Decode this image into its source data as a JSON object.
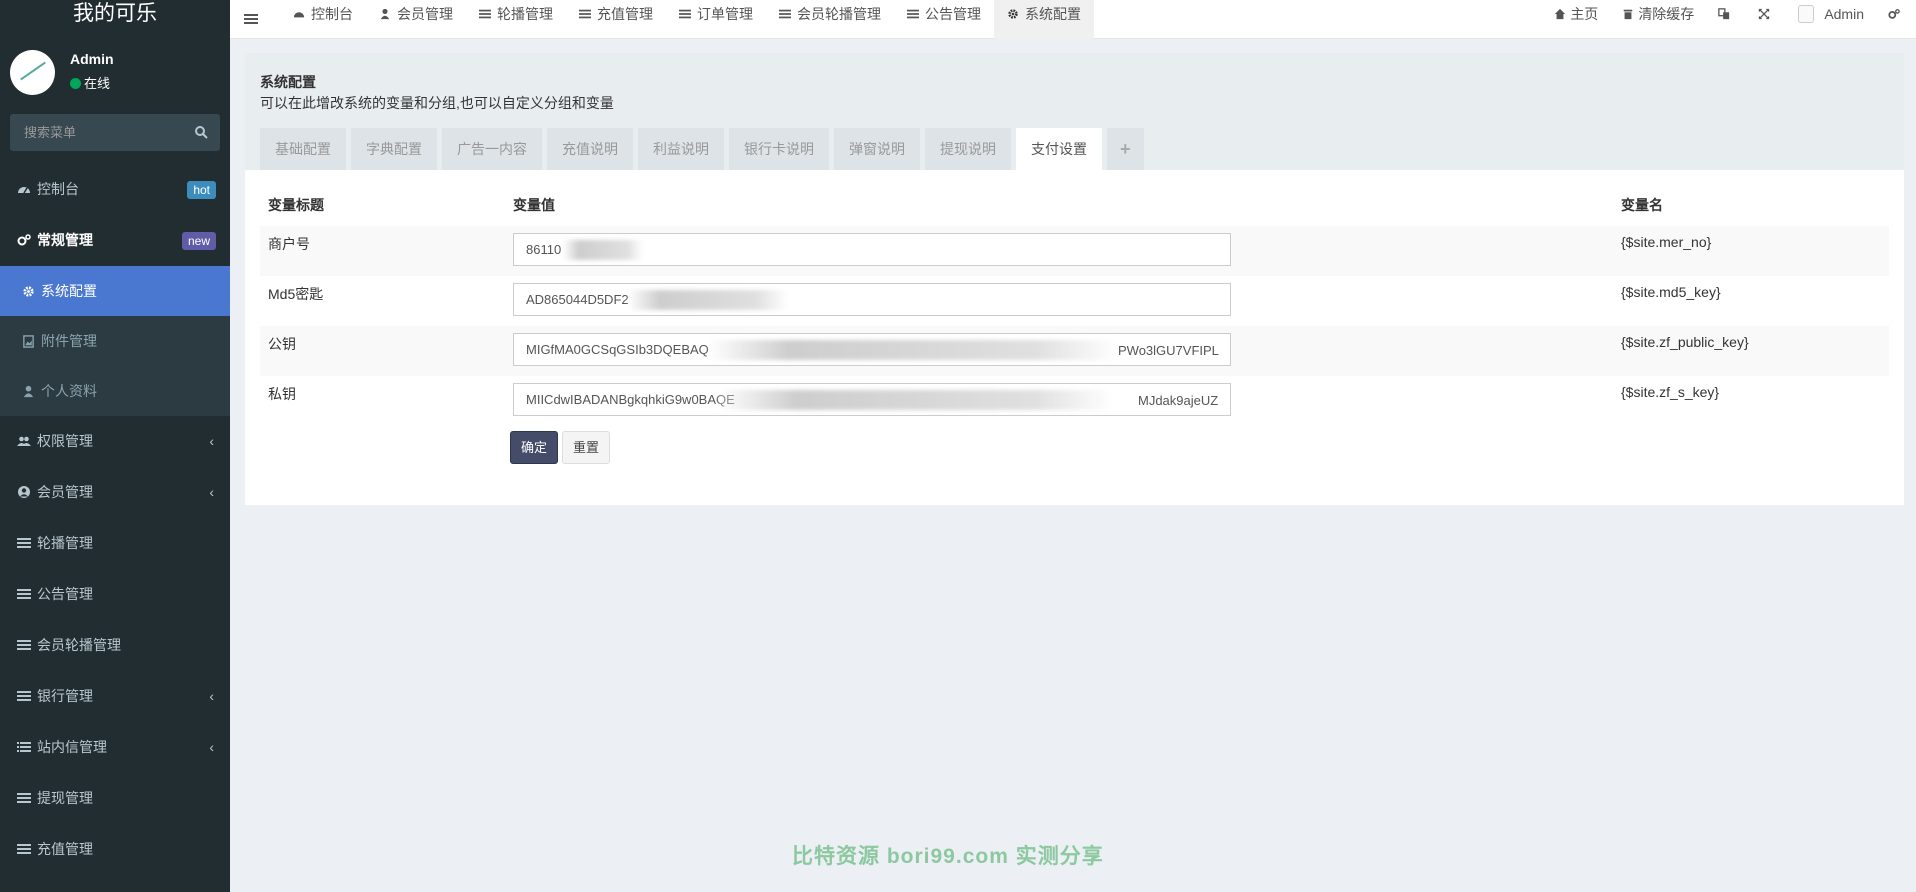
{
  "sidebar": {
    "logo": "我的可乐",
    "user": {
      "name": "Admin",
      "status": "在线"
    },
    "search_placeholder": "搜索菜单",
    "items": [
      {
        "label": "控制台",
        "badge": "hot"
      },
      {
        "label": "常规管理",
        "badge": "new"
      },
      {
        "label": "系统配置"
      },
      {
        "label": "附件管理"
      },
      {
        "label": "个人资料"
      },
      {
        "label": "权限管理",
        "chevron": "‹"
      },
      {
        "label": "会员管理",
        "chevron": "‹"
      },
      {
        "label": "轮播管理"
      },
      {
        "label": "公告管理"
      },
      {
        "label": "会员轮播管理"
      },
      {
        "label": "银行管理",
        "chevron": "‹"
      },
      {
        "label": "站内信管理",
        "chevron": "‹"
      },
      {
        "label": "提现管理"
      },
      {
        "label": "充值管理"
      }
    ]
  },
  "topnav": {
    "tabs": [
      "控制台",
      "会员管理",
      "轮播管理",
      "充值管理",
      "订单管理",
      "会员轮播管理",
      "公告管理",
      "系统配置"
    ],
    "right": {
      "home": "主页",
      "clear_cache": "清除缓存",
      "user": "Admin"
    }
  },
  "panel": {
    "title": "系统配置",
    "desc": "可以在此增改系统的变量和分组,也可以自定义分组和变量",
    "tabs": [
      "基础配置",
      "字典配置",
      "广告一内容",
      "充值说明",
      "利益说明",
      "银行卡说明",
      "弹窗说明",
      "提现说明",
      "支付设置"
    ],
    "plus": "+",
    "headers": {
      "title": "变量标题",
      "value": "变量值",
      "name": "变量名"
    },
    "rows": [
      {
        "title": "商户号",
        "value": "86110",
        "name": "{$site.mer_no}"
      },
      {
        "title": "Md5密匙",
        "value": "AD865044D5DF2",
        "name": "{$site.md5_key}"
      },
      {
        "title": "公钥",
        "value": "MIGfMA0GCSqGSIb3DQEBAQ",
        "value_tail": "PWo3lGU7VFIPL",
        "name": "{$site.zf_public_key}"
      },
      {
        "title": "私钥",
        "value": "MIICdwIBADANBgkqhkiG9w0BAQE",
        "value_tail": "MJdak9ajeUZ",
        "name": "{$site.zf_s_key}"
      }
    ],
    "buttons": {
      "submit": "确定",
      "reset": "重置"
    }
  },
  "watermark": "比特资源 bori99.com 实测分享",
  "colors": {
    "sidebar_bg": "#222d32",
    "active_item": "#4a78d0",
    "primary_button": "#444c69",
    "online": "#00a65a"
  }
}
